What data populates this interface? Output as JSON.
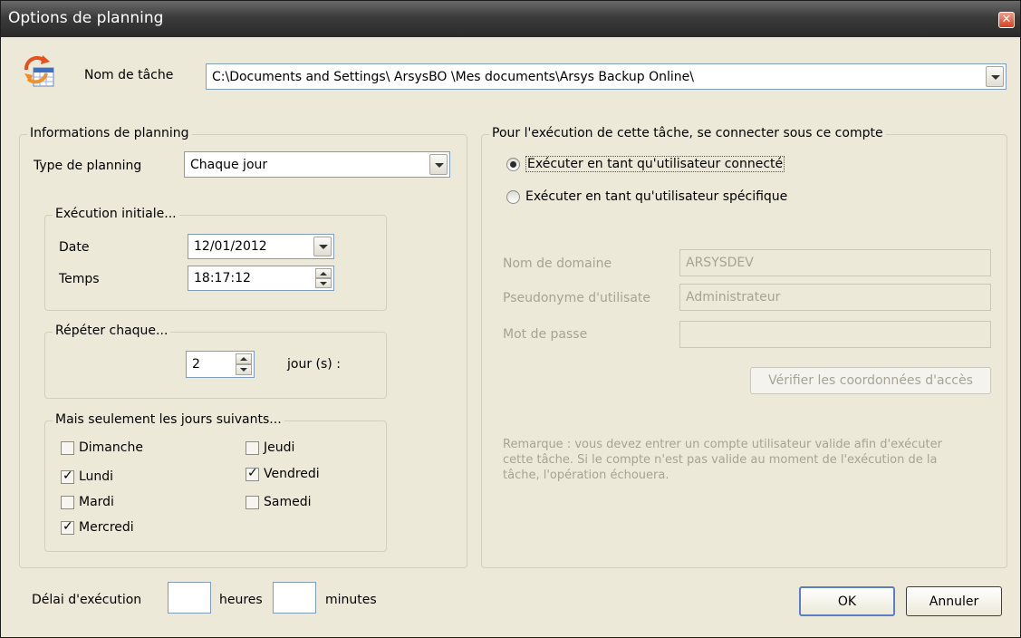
{
  "window": {
    "title": "Options de planning",
    "close_symbol": "✕"
  },
  "task": {
    "label": "Nom de tâche",
    "path": "C:\\Documents and Settings\\ ArsysBO \\Mes documents\\Arsys Backup Online\\"
  },
  "schedule_info": {
    "legend": "Informations de planning",
    "type_label": "Type de planning",
    "type_value": "Chaque jour",
    "initial": {
      "legend": "Exécution initiale...",
      "date_label": "Date",
      "date_value": "12/01/2012",
      "time_label": "Temps",
      "time_value": "18:17:12"
    },
    "repeat": {
      "legend": "Répéter chaque...",
      "value": "2",
      "unit": "jour (s) :"
    },
    "days": {
      "legend": "Mais seulement les jours suivants...",
      "items": [
        {
          "label": "Dimanche",
          "checked": false
        },
        {
          "label": "Lundi",
          "checked": true
        },
        {
          "label": "Mardi",
          "checked": false
        },
        {
          "label": "Mercredi",
          "checked": true
        },
        {
          "label": "Jeudi",
          "checked": false
        },
        {
          "label": "Vendredi",
          "checked": true
        },
        {
          "label": "Samedi",
          "checked": false
        }
      ]
    }
  },
  "account": {
    "legend": "Pour l'exécution de cette tâche, se connecter sous ce compte",
    "radio_connected": "Exécuter en tant qu'utilisateur connecté",
    "radio_specific": "Exécuter en tant qu'utilisateur spécifique",
    "selected": "connected",
    "domain_label": "Nom de domaine",
    "domain_value": "ARSYSDEV",
    "user_label": "Pseudonyme d'utilisate",
    "user_value": "Administrateur",
    "password_label": "Mot de passe",
    "password_value": "",
    "verify_button": "Vérifier les coordonnées d'accès",
    "note": "Remarque : vous devez entrer un compte utilisateur valide afin d'exécuter cette tâche. Si le compte n'est pas valide au moment de l'exécution de la tâche, l'opération échouera."
  },
  "delay": {
    "label": "Délai d'exécution",
    "hours_label": "heures",
    "minutes_label": "minutes",
    "hours_value": "",
    "minutes_value": ""
  },
  "buttons": {
    "ok": "OK",
    "cancel": "Annuler"
  }
}
